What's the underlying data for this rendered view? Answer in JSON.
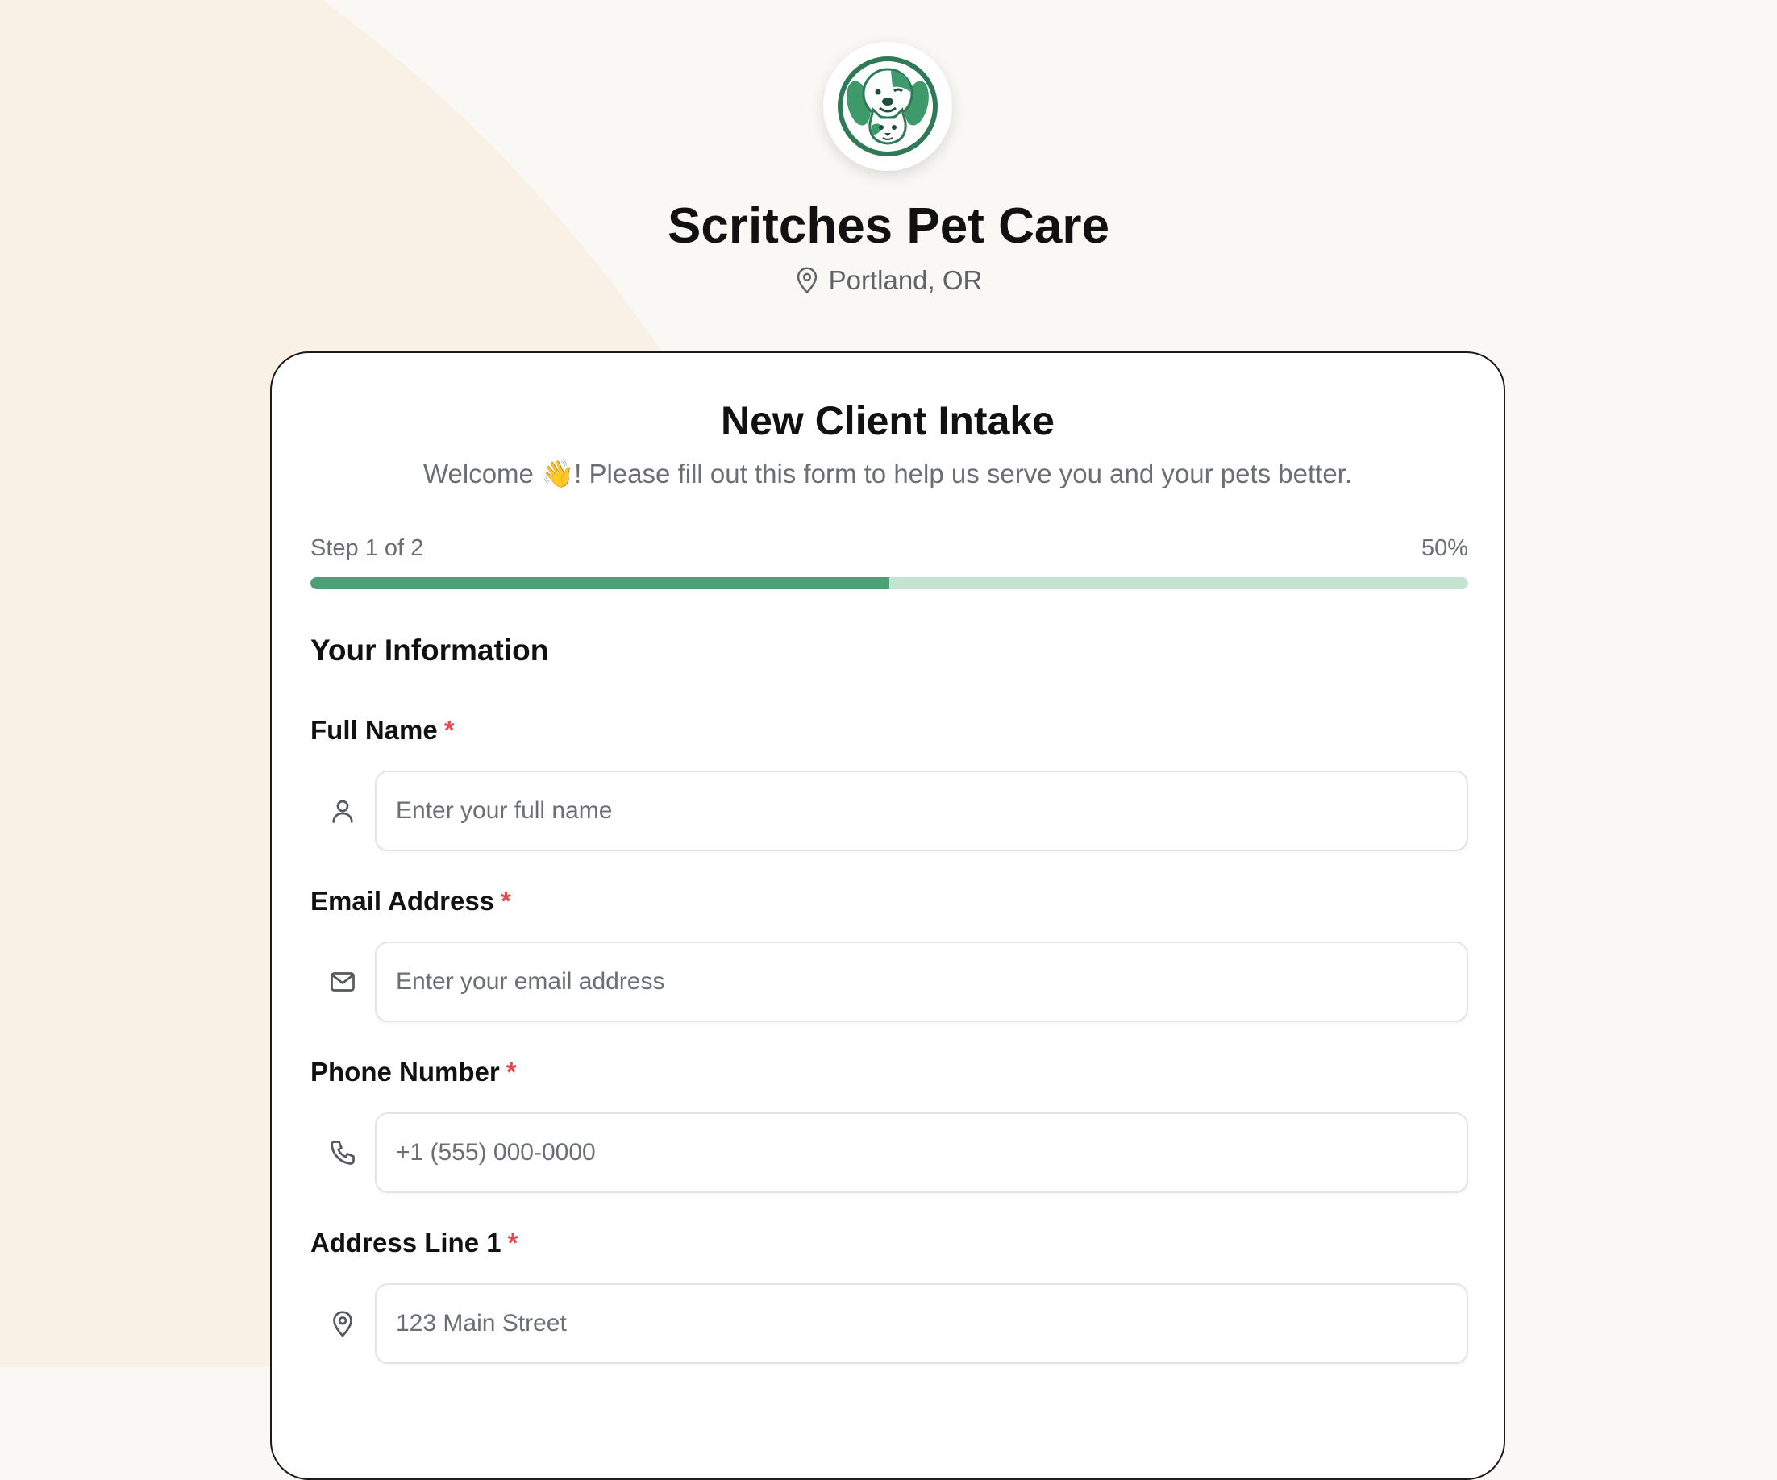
{
  "brand": {
    "name": "Scritches Pet Care",
    "location": "Portland, OR",
    "logo_icon": "dog-and-cat-logo-icon"
  },
  "colors": {
    "accent": "#4e9e76",
    "accent_light": "#c4e4d1",
    "required": "#e5484d",
    "background": "#faf8f5",
    "background_shape": "#faf1e6"
  },
  "form": {
    "title": "New Client Intake",
    "subtitle": "Welcome 👋! Please fill out this form to help us serve you and your pets better.",
    "step_label": "Step 1 of 2",
    "progress_label": "50%",
    "progress_value": 0.5,
    "section_title": "Your Information",
    "required_mark": "*",
    "fields": [
      {
        "label": "Full Name",
        "placeholder": "Enter your full name",
        "icon": "user-icon",
        "value": ""
      },
      {
        "label": "Email Address",
        "placeholder": "Enter your email address",
        "icon": "mail-icon",
        "value": ""
      },
      {
        "label": "Phone Number",
        "placeholder": "+1 (555) 000-0000",
        "icon": "phone-icon",
        "value": ""
      },
      {
        "label": "Address Line 1",
        "placeholder": "123 Main Street",
        "icon": "map-pin-icon",
        "value": ""
      }
    ]
  }
}
